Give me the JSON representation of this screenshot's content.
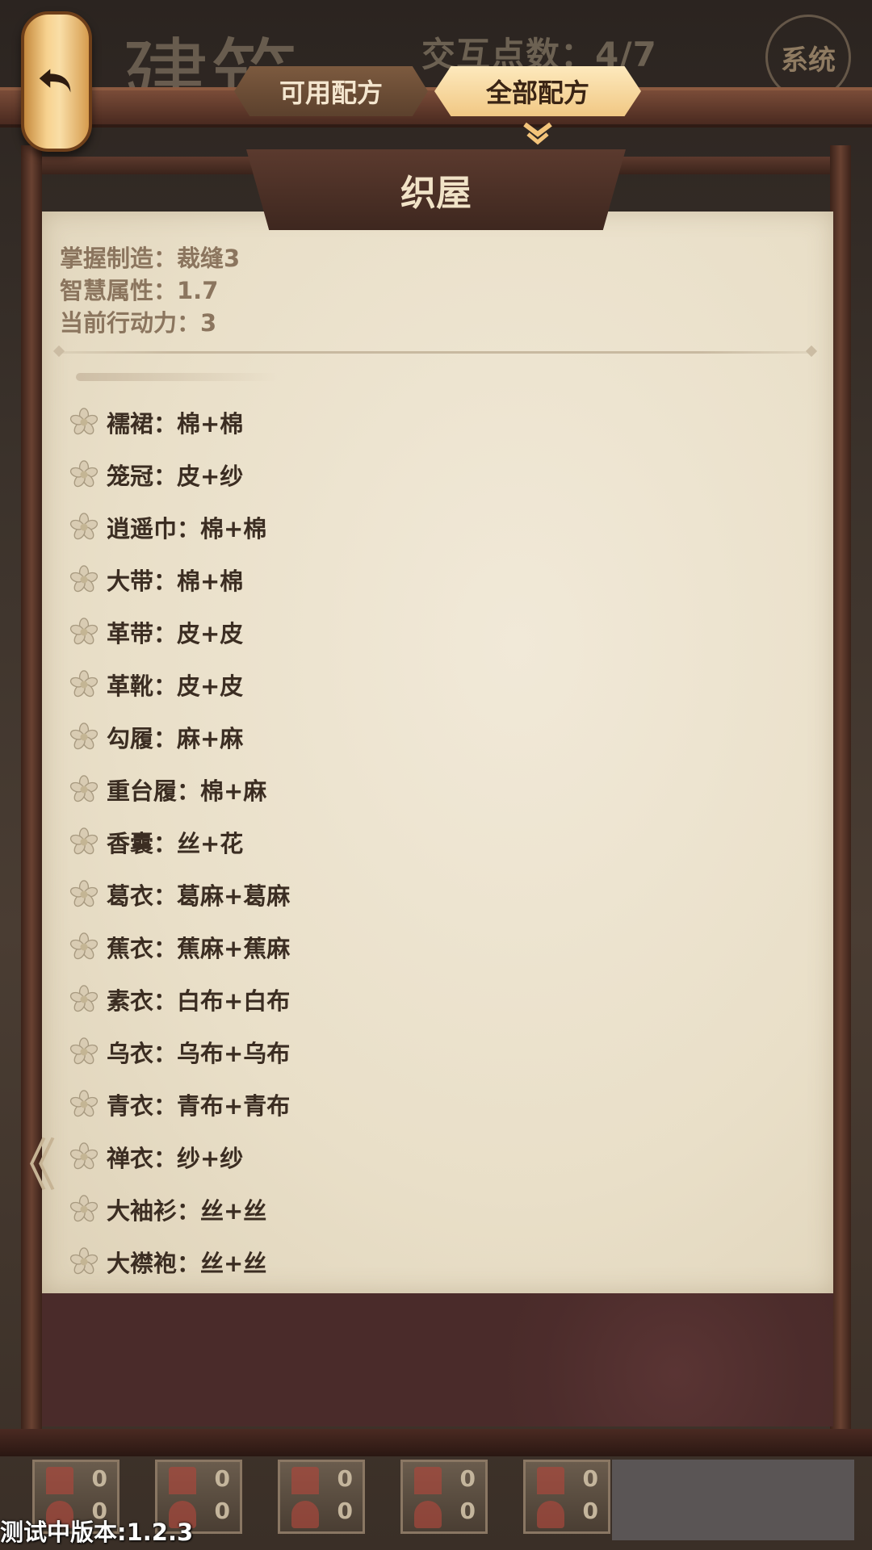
{
  "header": {
    "background_title": "建筑",
    "interaction_points": "交互点数：4/7",
    "system_label": "系统"
  },
  "tabs": [
    {
      "label": "可用配方",
      "active": false
    },
    {
      "label": "全部配方",
      "active": true
    }
  ],
  "building": {
    "title": "织屋",
    "stats": [
      "掌握制造：裁缝3",
      "智慧属性：1.7",
      "当前行动力：3"
    ]
  },
  "recipes": [
    "襦裙：棉+棉",
    "笼冠：皮+纱",
    "逍遥巾：棉+棉",
    "大带：棉+棉",
    "革带：皮+皮",
    "革靴：皮+皮",
    "勾履：麻+麻",
    "重台履：棉+麻",
    "香囊：丝+花",
    "葛衣：葛麻+葛麻",
    "蕉衣：蕉麻+蕉麻",
    "素衣：白布+白布",
    "乌衣：乌布+乌布",
    "青衣：青布+青布",
    "禅衣：纱+纱",
    "大袖衫：丝+丝",
    "大襟袍：丝+丝"
  ],
  "bottom_cards": [
    {
      "a": "0",
      "b": "0"
    },
    {
      "a": "0",
      "b": "0"
    },
    {
      "a": "0",
      "b": "0"
    },
    {
      "a": "0",
      "b": "0"
    },
    {
      "a": "0",
      "b": "0"
    }
  ],
  "version": "测试中版本:1.2.3",
  "icons": {
    "back": "back-arrow-icon",
    "recipe_bullet": "flower-icon",
    "page_prev": "chevron-left-icon"
  },
  "colors": {
    "paper": "#ede4d0",
    "frame": "#4a2a20",
    "tab_active": "#f6d596",
    "tab_inactive": "#6b4c35",
    "text_dark": "#3b2d22",
    "stat_text": "#8b755e"
  }
}
